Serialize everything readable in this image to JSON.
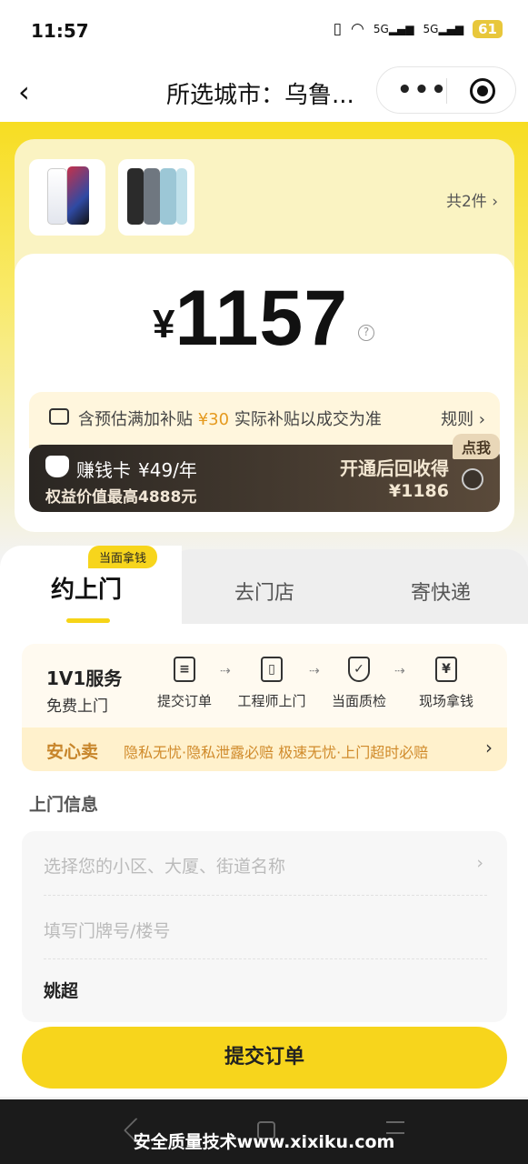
{
  "status_bar": {
    "time": "11:57",
    "network1": "5G",
    "network2": "5G",
    "battery": "61"
  },
  "nav": {
    "title": "所选城市：乌鲁...",
    "back_icon": "chevron-left-icon",
    "more_icon": "more-dots-icon",
    "close_icon": "target-icon"
  },
  "product": {
    "count": "共2件",
    "items": [
      "phone-white",
      "phone-multicolor"
    ]
  },
  "price": {
    "currency": "¥",
    "value": "1157"
  },
  "subsidy": {
    "prefix": "含预估满加补贴",
    "amount": "¥30",
    "suffix": "实际补贴以成交为准",
    "rule": "规则"
  },
  "earn_card": {
    "name": "赚钱卡",
    "price": "¥49/年",
    "benefit": "权益价值最高4888元",
    "after_label": "开通后回收得",
    "after_value": "¥1186",
    "tag": "点我"
  },
  "tabs": {
    "face_tag": "当面拿钱",
    "items": [
      "约上门",
      "去门店",
      "寄快递"
    ],
    "active": 0
  },
  "service": {
    "title": "1V1服务",
    "subtitle": "免费上门",
    "steps": [
      "提交订单",
      "工程师上门",
      "当面质检",
      "现场拿钱"
    ],
    "safe_label": "安心卖",
    "safe_text": "隐私无忧·隐私泄露必赔  极速无忧·上门超时必赔"
  },
  "visit": {
    "section_title": "上门信息",
    "address_placeholder": "选择您的小区、大厦、街道名称",
    "door_placeholder": "填写门牌号/楼号",
    "name": "姚超"
  },
  "submit_label": "提交订单",
  "watermark": "安全质量技术www.xixiku.com",
  "colors": {
    "accent": "#f7d51c",
    "highlight": "#e59a1f"
  }
}
